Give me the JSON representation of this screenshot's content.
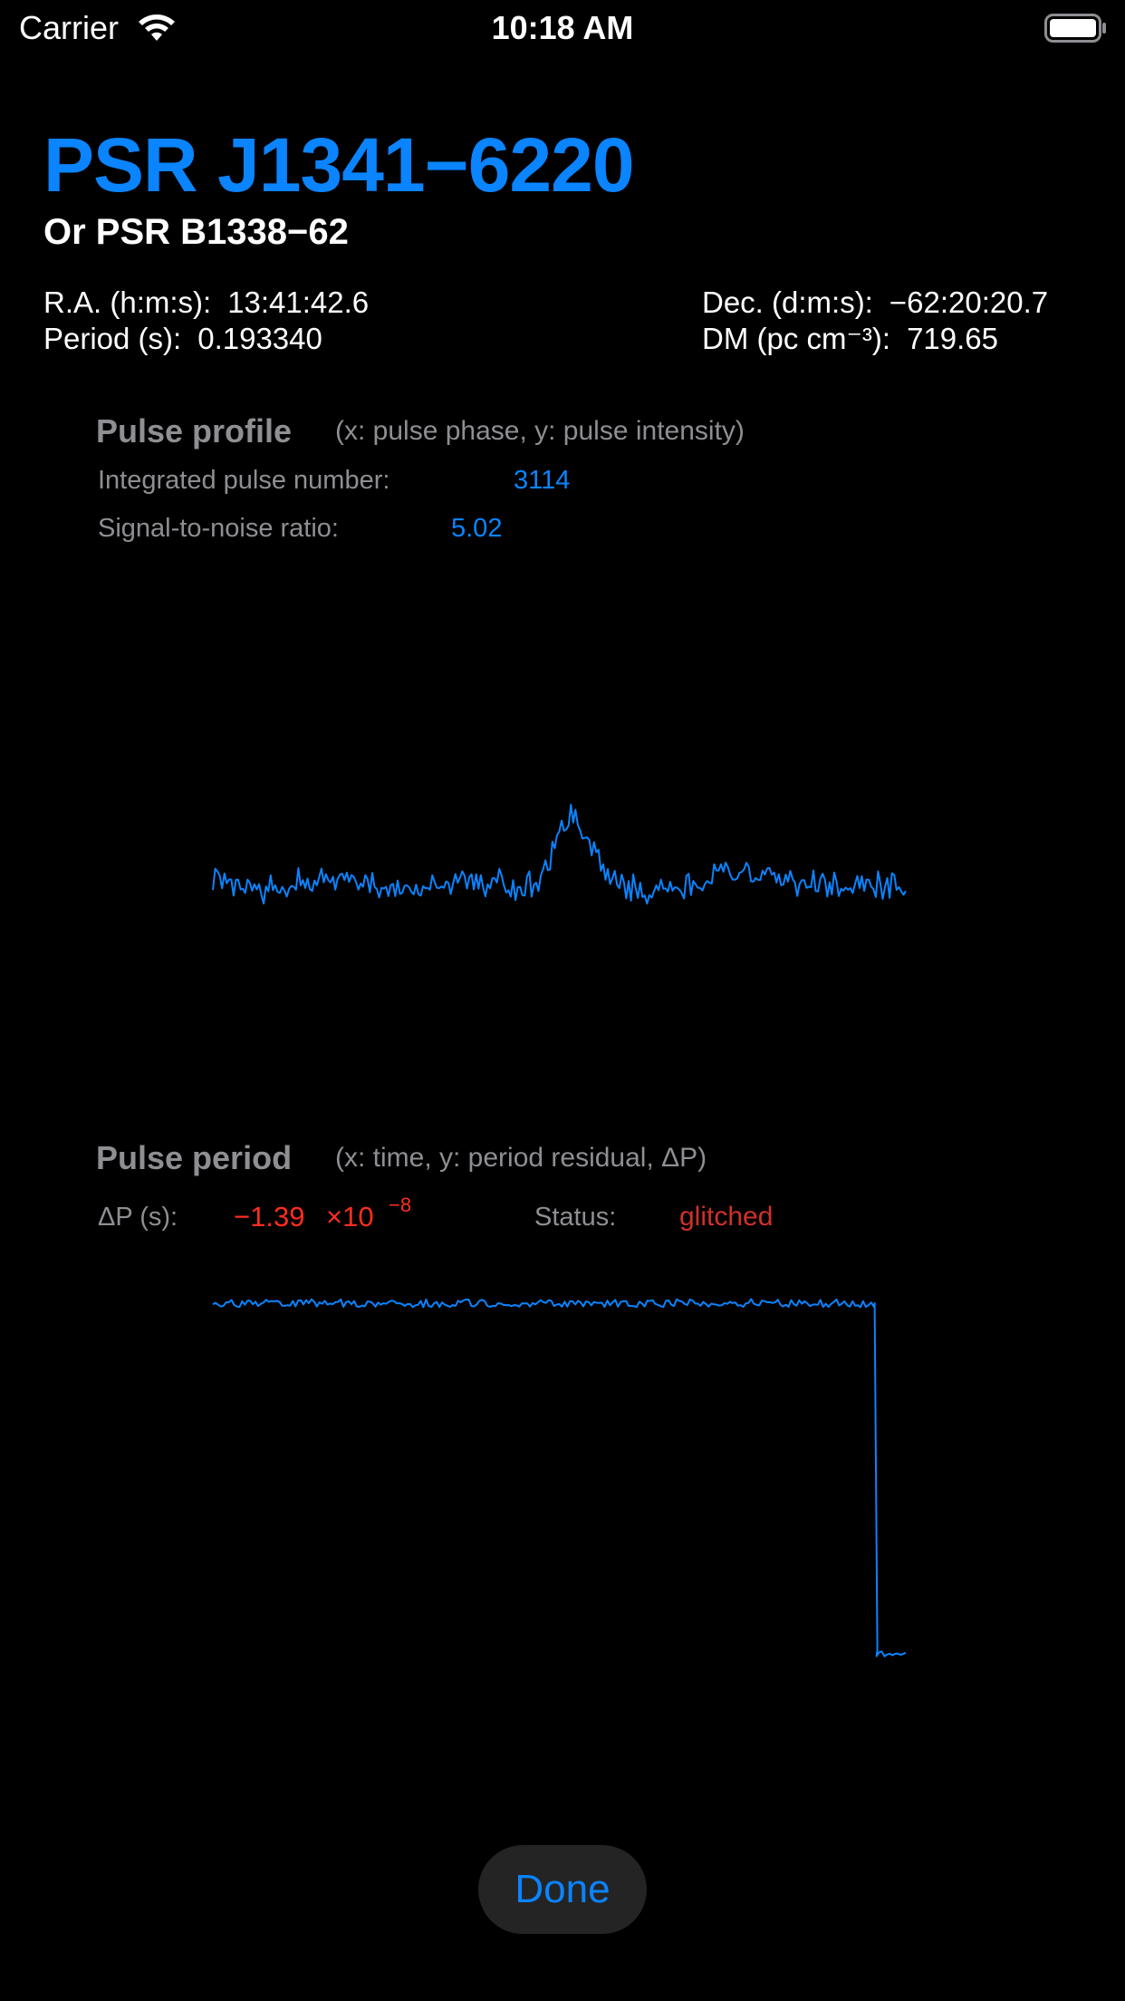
{
  "status_bar": {
    "carrier": "Carrier",
    "time": "10:18 AM",
    "wifi_icon": "wifi-icon",
    "battery_icon": "battery-icon"
  },
  "header": {
    "title": "PSR J1341−6220",
    "subtitle": "Or PSR B1338−62"
  },
  "info": {
    "ra_label": "R.A. (h:m:s):",
    "ra_value": "13:41:42.6",
    "period_label": "Period (s):",
    "period_value": "0.193340",
    "dec_label": "Dec. (d:m:s):",
    "dec_value": "−62:20:20.7",
    "dm_label": "DM (pc cm⁻³):",
    "dm_value": "719.65"
  },
  "pulse_profile": {
    "title": "Pulse profile",
    "note": "(x: pulse phase, y: pulse intensity)",
    "integrated_label": "Integrated pulse number:",
    "integrated_value": "3114",
    "snr_label": "Signal-to-noise ratio:",
    "snr_value": "5.02"
  },
  "pulse_period": {
    "title": "Pulse period",
    "note": "(x: time, y: period residual, ΔP)",
    "dp_label": "ΔP (s):",
    "dp_value": "−1.39",
    "dp_multiplier": "×10",
    "dp_exponent": "−8",
    "status_label": "Status:",
    "status_value": "glitched"
  },
  "done_label": "Done",
  "colors": {
    "accent": "#0a84ff",
    "label": "#8e8e93",
    "negative": "#ff2d20",
    "status_bad": "#d0312a",
    "background": "#000000"
  },
  "chart_data": [
    {
      "type": "line",
      "name": "pulse-profile",
      "xlabel": "pulse phase",
      "ylabel": "pulse intensity",
      "grid": false,
      "peak_phase": 0.52,
      "description_values": {
        "x_range": [
          0,
          1
        ],
        "baseline": 0.0,
        "peak": 1.0
      }
    },
    {
      "type": "line",
      "name": "pulse-period",
      "xlabel": "time",
      "ylabel": "period residual, ΔP",
      "grid": false,
      "description_values": {
        "x_range": [
          0,
          1
        ],
        "pre_glitch_level": 0.0,
        "glitch_time": 0.955,
        "post_glitch_level": -1.0
      }
    }
  ]
}
